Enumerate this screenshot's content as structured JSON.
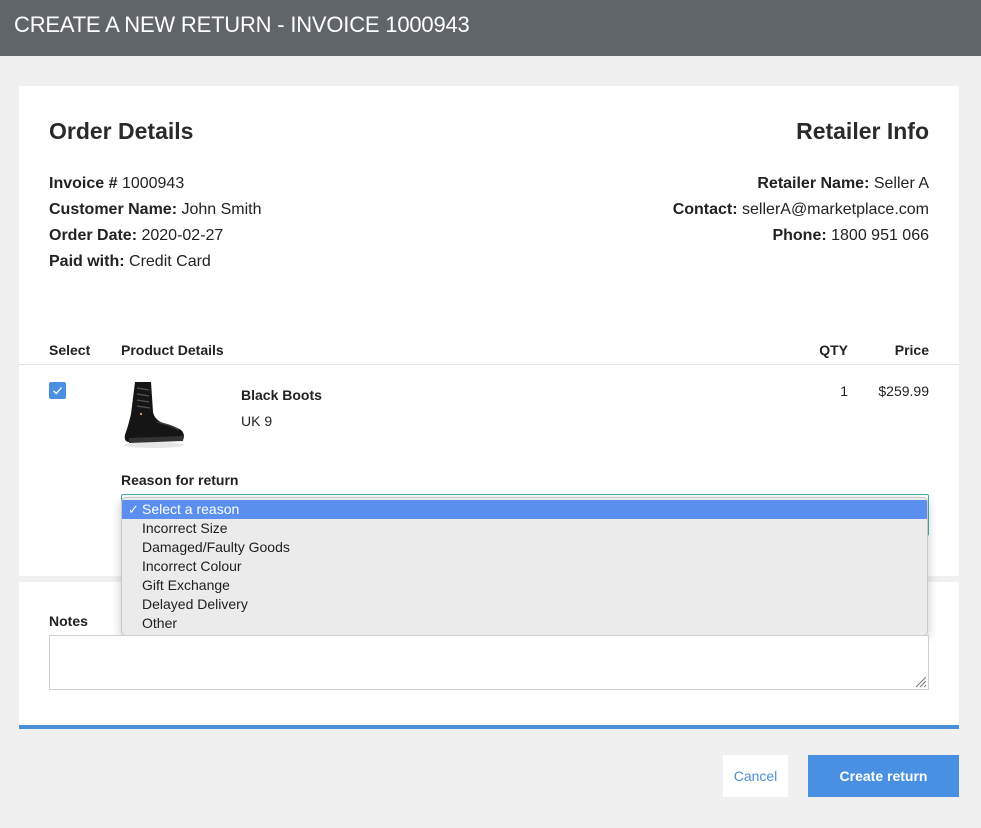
{
  "header": {
    "title": "CREATE A NEW RETURN - INVOICE 1000943"
  },
  "order": {
    "heading": "Order Details",
    "invoice_label": "Invoice #",
    "invoice_value": "1000943",
    "customer_label": "Customer Name:",
    "customer_value": "John Smith",
    "date_label": "Order Date:",
    "date_value": "2020-02-27",
    "paid_label": "Paid with:",
    "paid_value": "Credit Card"
  },
  "retailer": {
    "heading": "Retailer Info",
    "name_label": "Retailer Name:",
    "name_value": "Seller A",
    "contact_label": "Contact:",
    "contact_value": "sellerA@marketplace.com",
    "phone_label": "Phone:",
    "phone_value": "1800 951 066"
  },
  "table": {
    "headers": {
      "select": "Select",
      "product": "Product Details",
      "qty": "QTY",
      "price": "Price"
    },
    "rows": [
      {
        "selected": true,
        "name": "Black Boots",
        "size": "UK 9",
        "qty": "1",
        "price": "$259.99",
        "image_icon": "black-boot-image"
      }
    ]
  },
  "reason": {
    "label": "Reason for return",
    "check_mark": "✓",
    "options": [
      "Select a reason",
      "Incorrect Size",
      "Damaged/Faulty Goods",
      "Incorrect Colour",
      "Gift Exchange",
      "Delayed Delivery",
      "Other"
    ],
    "selected_index": 0
  },
  "notes": {
    "label": "Notes",
    "value": ""
  },
  "actions": {
    "cancel": "Cancel",
    "create": "Create return"
  },
  "colors": {
    "header_bg": "#60656a",
    "accent": "#4a90e2",
    "select_border": "#41b4a8",
    "highlight": "#5a8ff0"
  }
}
